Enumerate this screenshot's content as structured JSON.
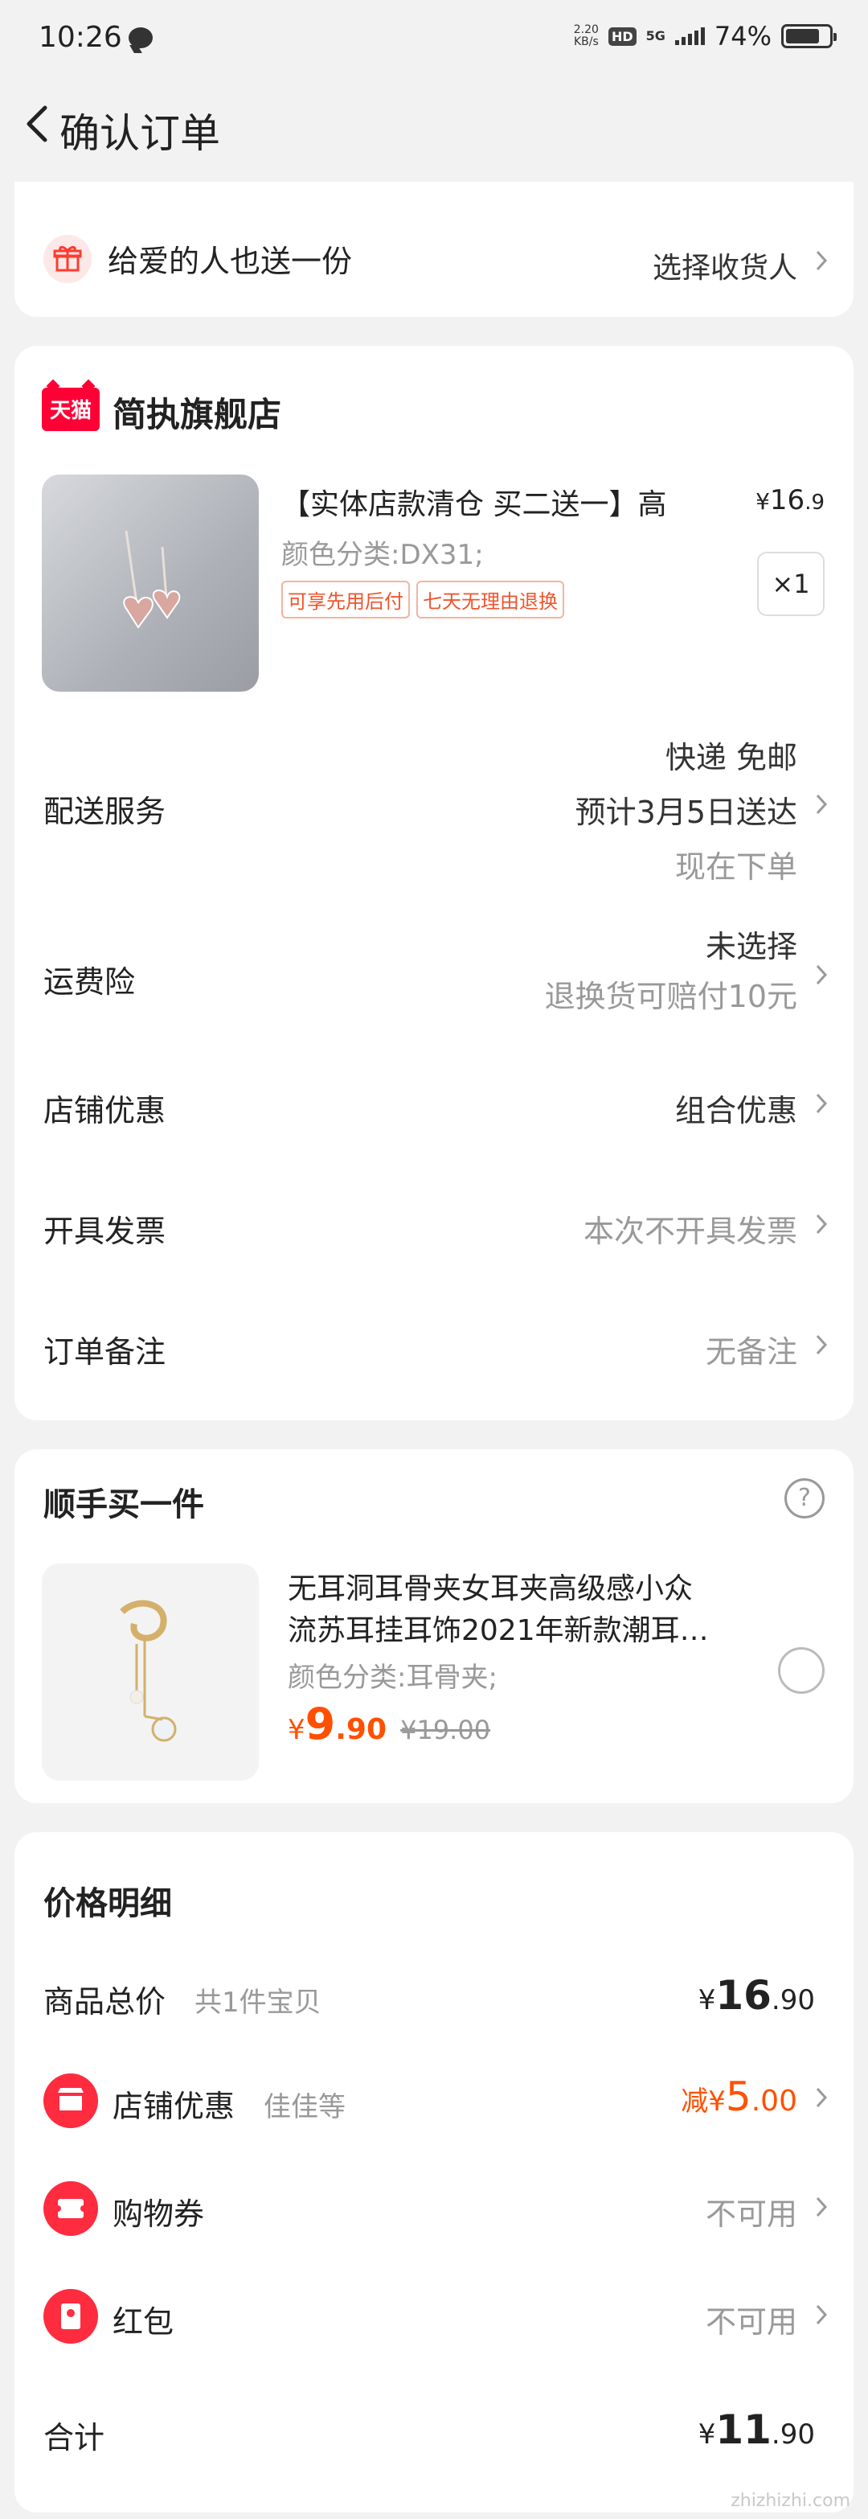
{
  "status_bar": {
    "time": "10:26",
    "speed": "2.20",
    "speed_unit": "KB/s",
    "hd": "HD",
    "net": "5G",
    "battery": "74%"
  },
  "nav": {
    "title": "确认订单"
  },
  "gift_row": {
    "label": "给爱的人也送一份",
    "action": "选择收货人"
  },
  "store": {
    "logo_text": "天猫",
    "name": "简执旗舰店",
    "product": {
      "title": "【实体店款清仓 买二送一】高",
      "spec": "颜色分类:DX31;",
      "tags": [
        "可享先用后付",
        "七天无理由退换"
      ],
      "price_symbol": "¥",
      "price_int": "16",
      "price_dec": ".9",
      "qty": "×1"
    },
    "delivery": {
      "label": "配送服务",
      "line1": "快递 免邮",
      "line2": "预计3月5日送达",
      "line3": "现在下单"
    },
    "insurance": {
      "label": "运费险",
      "line1": "未选择",
      "line2": "退换货可赔付10元"
    },
    "discount": {
      "label": "店铺优惠",
      "value": "组合优惠"
    },
    "invoice": {
      "label": "开具发票",
      "value": "本次不开具发票"
    },
    "note": {
      "label": "订单备注",
      "value": "无备注"
    }
  },
  "addon": {
    "title": "顺手买一件",
    "help": "?",
    "product": {
      "title_line1": "无耳洞耳骨夹女耳夹高级感小众",
      "title_line2": "流苏耳挂耳饰2021年新款潮耳…",
      "spec": "颜色分类:耳骨夹;",
      "price_symbol": "¥",
      "price_int": "9",
      "price_dec": ".90",
      "orig_price": "¥19.00"
    }
  },
  "price_detail": {
    "title": "价格明细",
    "total_goods": {
      "label": "商品总价",
      "sub": "共1件宝贝",
      "symbol": "¥",
      "int": "16",
      "dec": ".90"
    },
    "store_discount": {
      "label": "店铺优惠",
      "sub": "佳佳等",
      "prefix": "减",
      "symbol": "¥",
      "int": "5",
      "dec": ".00"
    },
    "coupon": {
      "label": "购物券",
      "value": "不可用"
    },
    "redpacket": {
      "label": "红包",
      "value": "不可用"
    },
    "sum": {
      "label": "合计",
      "symbol": "¥",
      "int": "11",
      "dec": ".90"
    }
  },
  "watermark": {
    "text": "zhizhizhi.com"
  },
  "colors": {
    "accent": "#ff5000",
    "tmall_red": "#ff0036",
    "bg": "#f2f2f2"
  }
}
